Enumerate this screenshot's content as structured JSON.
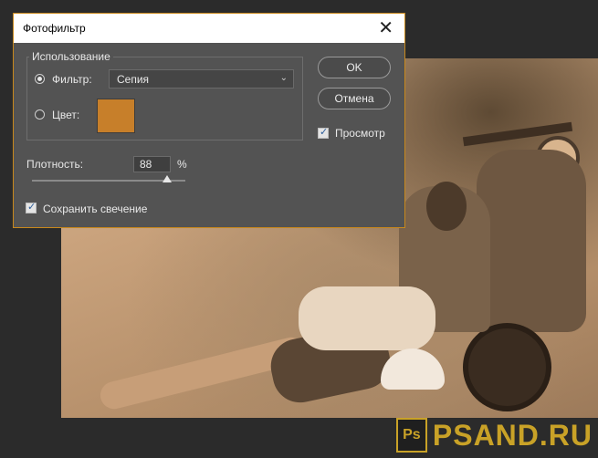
{
  "dialog": {
    "title": "Фотофильтр",
    "group_title": "Использование",
    "filter_label": "Фильтр:",
    "filter_value": "Сепия",
    "color_label": "Цвет:",
    "color_swatch": "#c77f2a",
    "ok_label": "OK",
    "cancel_label": "Отмена",
    "preview_label": "Просмотр",
    "preview_checked": true,
    "density_label": "Плотность:",
    "density_value": "88",
    "density_unit": "%",
    "density_fraction": 0.88,
    "preserve_label": "Сохранить свечение",
    "preserve_checked": true,
    "filter_selected": true
  },
  "watermark": {
    "ps": "Ps",
    "brand": "PSAND.RU",
    "color": "#c9a227"
  },
  "accent_border": "#c8881c"
}
